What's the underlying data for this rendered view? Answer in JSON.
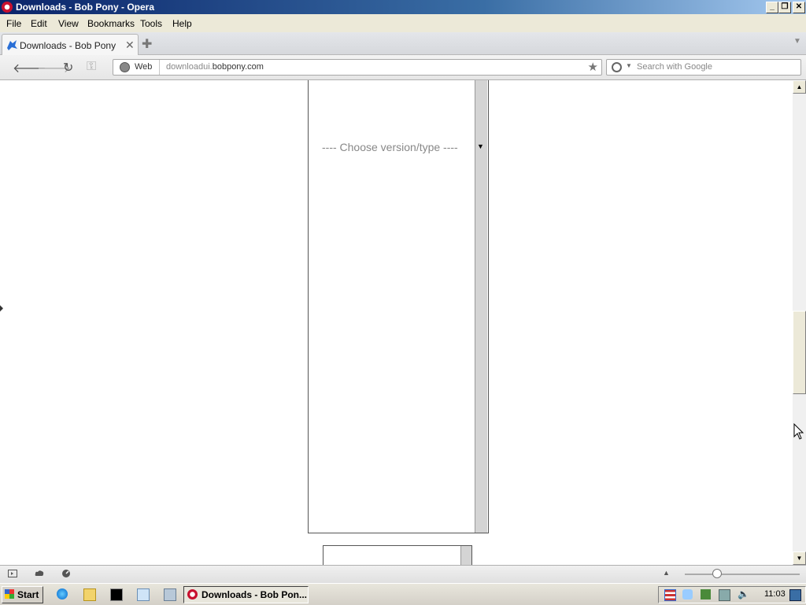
{
  "window": {
    "title": "Downloads - Bob Pony - Opera",
    "minimize_icon": "minimize-icon",
    "restore_icon": "restore-icon",
    "close_icon": "close-icon"
  },
  "menu": {
    "items": [
      "File",
      "Edit",
      "View",
      "Bookmarks",
      "Tools",
      "Help"
    ]
  },
  "tabs": [
    {
      "label": "Downloads - Bob Pony",
      "active": true
    }
  ],
  "navbar": {
    "back_icon": "back-arrow-icon",
    "forward_icon": "forward-arrow-icon",
    "reload_icon": "reload-icon",
    "key_icon": "key-icon",
    "web_label": "Web",
    "url_subdomain": "downloadui.",
    "url_domain": "bobpony.com",
    "search_placeholder": "Search with Google"
  },
  "content": {
    "version_select_text": "---- Choose version/type ----"
  },
  "taskbar": {
    "start_label": "Start",
    "task_label": "Downloads - Bob Pon...",
    "clock": "11:03"
  },
  "colors": {
    "titlebar": "#0a246a",
    "opera_red": "#c8102e",
    "select_text": "#888888"
  }
}
